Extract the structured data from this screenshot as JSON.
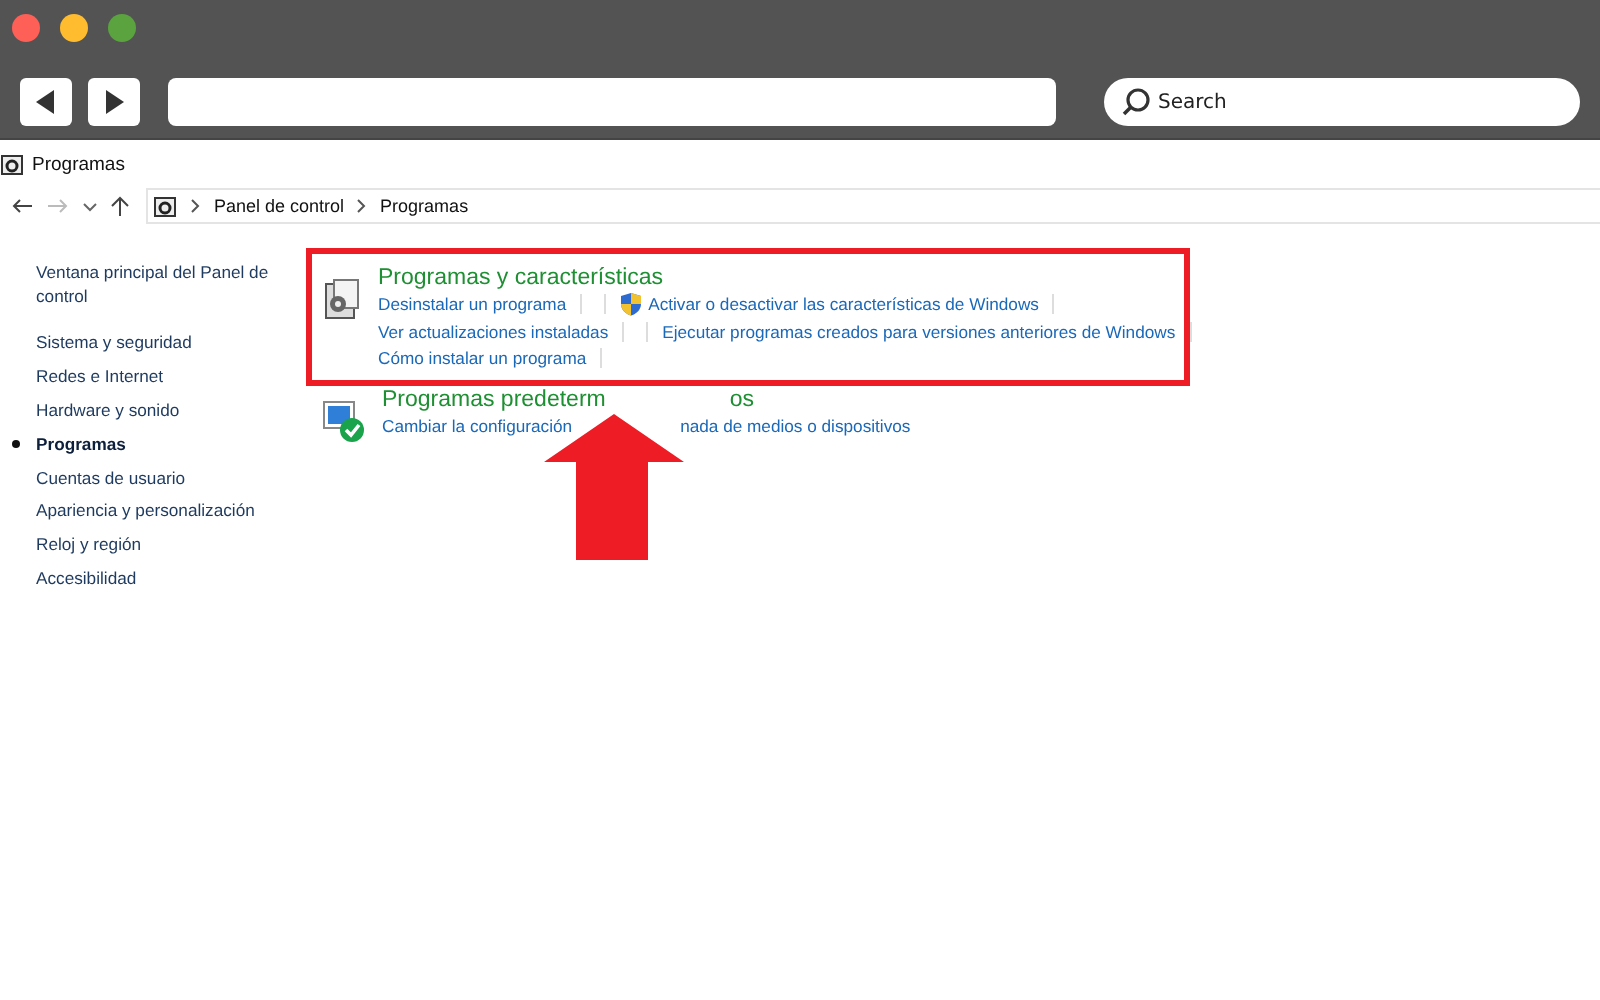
{
  "browser": {
    "search_placeholder": "Search"
  },
  "window": {
    "title": "Programas"
  },
  "breadcrumb": [
    "Panel de control",
    "Programas"
  ],
  "sidebar": {
    "items": [
      {
        "label": "Ventana principal del Panel de control",
        "selected": false
      },
      {
        "label": "Sistema y seguridad",
        "selected": false
      },
      {
        "label": "Redes e Internet",
        "selected": false
      },
      {
        "label": "Hardware y sonido",
        "selected": false
      },
      {
        "label": "Programas",
        "selected": true
      },
      {
        "label": "Cuentas de usuario",
        "selected": false
      },
      {
        "label": "Apariencia y personalización",
        "selected": false
      },
      {
        "label": "Reloj y región",
        "selected": false
      },
      {
        "label": "Accesibilidad",
        "selected": false
      }
    ]
  },
  "sections": [
    {
      "kind": "features",
      "highlighted": true,
      "title_parts": [
        "Programas y características"
      ],
      "link_rows": [
        [
          {
            "text": "Desinstalar un programa",
            "kind": "plain"
          },
          {
            "text": "Activar o desactivar las características de Windows",
            "kind": "shield"
          }
        ],
        [
          {
            "text": "Ver actualizaciones instaladas",
            "kind": "plain"
          },
          {
            "text": "Ejecutar programas creados para versiones anteriores de Windows",
            "kind": "plain"
          }
        ],
        [
          {
            "text": "Cómo instalar un programa",
            "kind": "plain"
          }
        ]
      ]
    },
    {
      "kind": "defaults",
      "highlighted": false,
      "title_parts": [
        "Programas predeterm",
        "os"
      ],
      "link_rows": [
        [
          {
            "text": "Cambiar la configuración",
            "kind": "plain"
          },
          {
            "text": "nada de medios o dispositivos",
            "kind": "gap"
          }
        ]
      ]
    }
  ]
}
